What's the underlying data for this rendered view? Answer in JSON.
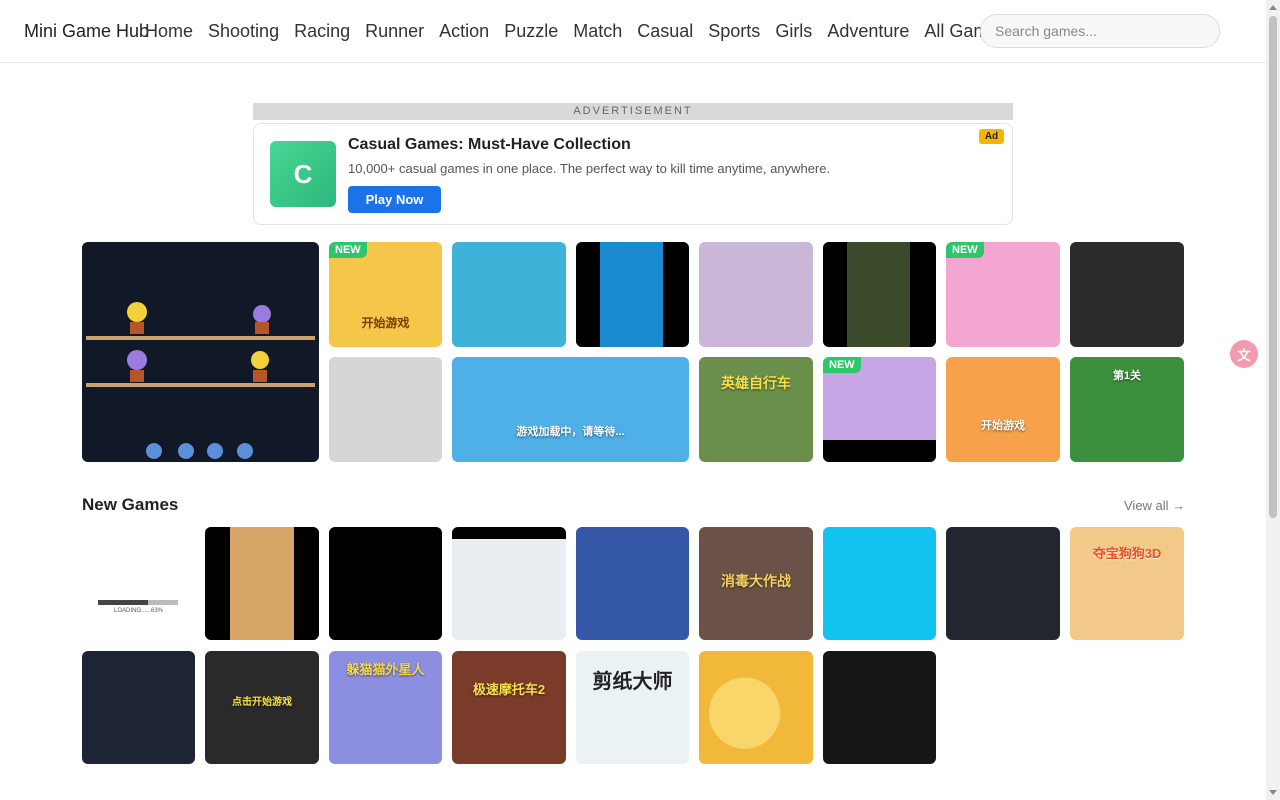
{
  "header": {
    "brand": "Mini Game Hub",
    "nav": [
      "Home",
      "Shooting",
      "Racing",
      "Runner",
      "Action",
      "Puzzle",
      "Match",
      "Casual",
      "Sports",
      "Girls",
      "Adventure",
      "All Games"
    ],
    "search_placeholder": "Search games..."
  },
  "ad": {
    "label": "ADVERTISEMENT",
    "logo_letter": "C",
    "title": "Casual Games: Must-Have Collection",
    "description": "10,000+ casual games in one place. The perfect way to kill time anytime, anywhere.",
    "cta": "Play Now",
    "badge": "Ad"
  },
  "featured": {
    "new_badge": "NEW",
    "tiles": [
      {
        "color": "#111827",
        "caption": ""
      },
      {
        "color": "#f4c64a",
        "caption": "开始游戏",
        "badge": true
      },
      {
        "color": "#3fb2d9",
        "caption": ""
      },
      {
        "color": "#1a8ad1",
        "caption": ""
      },
      {
        "color": "#c9b6d8",
        "caption": ""
      },
      {
        "color": "#3a4a2b",
        "caption": ""
      },
      {
        "color": "#f2a6d1",
        "caption": "",
        "badge": true
      },
      {
        "color": "#2b2b2b",
        "caption": ""
      },
      {
        "color": "#d6d6d6",
        "caption": ""
      },
      {
        "color": "#4fb0e8",
        "caption": "游戏加载中，请等待..."
      },
      {
        "color": "#6a8f4a",
        "caption": "英雄自行车"
      },
      {
        "color": "#c8a6e6",
        "caption": "",
        "badge": true
      },
      {
        "color": "#f7a24a",
        "caption": "开始游戏"
      },
      {
        "color": "#3c8f3c",
        "caption": "第1关"
      }
    ]
  },
  "new_games": {
    "title": "New Games",
    "view_all": "View all →",
    "loading_text": "LOADING......63%",
    "tiles": [
      {
        "color": "#ffffff",
        "caption": ""
      },
      {
        "color": "#d7a565",
        "caption": ""
      },
      {
        "color": "#000000",
        "caption": ""
      },
      {
        "color": "#e9eef3",
        "caption": ""
      },
      {
        "color": "#3557a8",
        "caption": ""
      },
      {
        "color": "#6b5248",
        "caption": "消毒大作战"
      },
      {
        "color": "#12c4ef",
        "caption": ""
      },
      {
        "color": "#22262e",
        "caption": ""
      },
      {
        "color": "#f3c98a",
        "caption": "夺宝狗狗3D"
      },
      {
        "color": "#1c2436",
        "caption": ""
      },
      {
        "color": "#2a2a2a",
        "caption": "点击开始游戏"
      },
      {
        "color": "#8c8fe0",
        "caption": "躲猫猫外星人"
      },
      {
        "color": "#7a3b2a",
        "caption": "极速摩托车2"
      },
      {
        "color": "#eaf2f6",
        "caption": "剪纸大师"
      },
      {
        "color": "#f2b83a",
        "caption": ""
      },
      {
        "color": "#161616",
        "caption": ""
      }
    ]
  }
}
